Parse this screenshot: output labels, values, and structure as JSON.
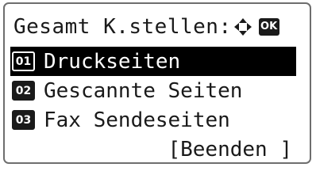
{
  "screen": {
    "title": "Gesamt K.stellen:",
    "nav_icon": "four-way-arrows-icon",
    "ok_label": "OK"
  },
  "menu": {
    "items": [
      {
        "number": "01",
        "label": "Druckseiten",
        "selected": true
      },
      {
        "number": "02",
        "label": "Gescannte Seiten",
        "selected": false
      },
      {
        "number": "03",
        "label": "Fax Sendeseiten",
        "selected": false
      }
    ],
    "end_label": "[Beenden ]"
  }
}
